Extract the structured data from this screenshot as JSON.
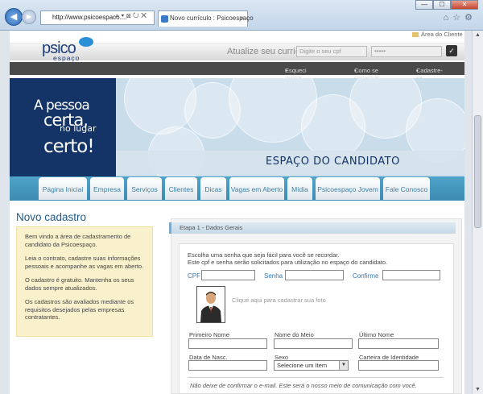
{
  "browser": {
    "url": "http://www.psicoespaco....",
    "tab_title": "Novo currículo : Psicoespaço",
    "tab_close": "×",
    "back_glyph": "◀",
    "forward_glyph": "▶",
    "addr_tools": "⌕ ▾ ⊠ ↻ ✕",
    "toolbar_icons": "⌂☆⚙",
    "win": {
      "min": "—",
      "max": "☐",
      "close": "✕"
    }
  },
  "header": {
    "area_cliente": "Área do Cliente",
    "logo_top": "psico",
    "logo_bottom": "espaço",
    "atualize": "Atualize seu currículo",
    "cpf_placeholder": "Digite o seu cpf",
    "password_value": "•••••",
    "ok_glyph": "✓",
    "links": [
      "Esqueci minha senha",
      "Como se cadastrar",
      "Cadastre-se"
    ],
    "link_bullet": "•"
  },
  "banner": {
    "slogan": [
      "A pessoa",
      "certa,",
      "no lugar",
      "certo!"
    ],
    "title": "ESPAÇO DO CANDIDATO"
  },
  "nav": [
    "Página Inicial",
    "Empresa",
    "Serviços",
    "Clientes",
    "Dicas",
    "Vagas em Aberto",
    "Mídia",
    "Psicoespaço Jovem",
    "Fale Conosco"
  ],
  "left": {
    "title": "Novo cadastro",
    "paragraphs": [
      "Bem vindo a área de cadastramento de candidato da Psicoespaço.",
      "Leia o contrato, cadastre suas informações pessoais e acompanhe as vagas em aberto.",
      "O cadastro é gratuito. Mantenha os seus dados sempre atualizados.",
      "Os cadastros são avaliados mediante os requisitos desejados pelas empresas contratantes."
    ]
  },
  "form": {
    "step": "Etapa 1 - Dados Gerais",
    "intro_1": "Escolha uma senha que seja fácil para você se recordar.",
    "intro_2": "Este cpf e senha serão solicitados para utilização no espaço do candidato.",
    "label_cpf": "CPF",
    "label_senha": "Senha",
    "label_confirme": "Confirme",
    "photo_text": "Clique aqui para cadastrar sua foto",
    "label_primeiro": "Primeiro Nome",
    "label_meio": "Nome do Meio",
    "label_ultimo": "Último Nome",
    "label_nasc": "Data de Nasc.",
    "label_sexo": "Sexo",
    "label_identidade": "Carteira de Identidade",
    "sexo_selected": "Selecione um Item",
    "select_arrow": "▼",
    "note": "Não deixe de confirmar o e-mail. Este será o nosso meio de comunicação com você."
  },
  "scrollbar": {
    "up": "▲",
    "down": "▼"
  }
}
